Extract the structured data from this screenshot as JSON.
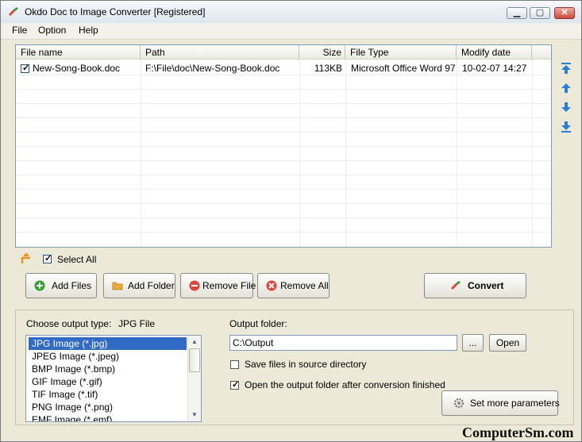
{
  "window": {
    "title": "Okdo Doc to Image Converter [Registered]"
  },
  "menu": [
    "File",
    "Option",
    "Help"
  ],
  "file_table": {
    "columns": [
      "File name",
      "Path",
      "Size",
      "File Type",
      "Modify date"
    ],
    "rows": [
      {
        "checked": true,
        "name": "New-Song-Book.doc",
        "path": "F:\\File\\doc\\New-Song-Book.doc",
        "size": "113KB",
        "type": "Microsoft Office Word 97...",
        "date": "10-02-07 14:27"
      }
    ]
  },
  "select_all": {
    "label": "Select All",
    "checked": true
  },
  "buttons": {
    "add_files": "Add Files",
    "add_folder": "Add Folder",
    "remove_file": "Remove File",
    "remove_all": "Remove All",
    "convert": "Convert",
    "browse": "...",
    "open": "Open",
    "set_more": "Set more parameters"
  },
  "output_type": {
    "label": "Choose output type:",
    "selected": "JPG File",
    "options": [
      "JPG Image (*.jpg)",
      "JPEG Image (*.jpeg)",
      "BMP Image (*.bmp)",
      "GIF Image (*.gif)",
      "TIF Image (*.tif)",
      "PNG Image (*.png)",
      "EMF Image (*.emf)"
    ]
  },
  "output_folder": {
    "label": "Output folder:",
    "value": "C:\\Output"
  },
  "options": {
    "save_in_source": {
      "label": "Save files in source directory",
      "checked": false
    },
    "open_after": {
      "label": "Open the output folder after conversion finished",
      "checked": true
    }
  },
  "watermark": "ComputerSm.com",
  "colors": {
    "accent_blue": "#316ac5",
    "icon_blue": "#2a7fd4",
    "add_green": "#2ea02e",
    "remove_red": "#d9463c"
  }
}
